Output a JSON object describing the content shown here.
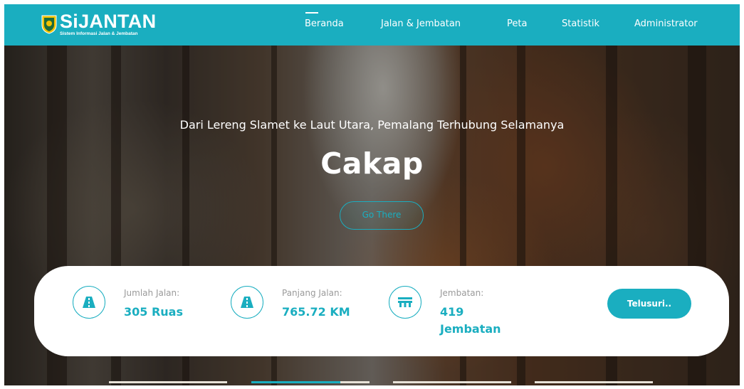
{
  "brand": {
    "name": "SiJANTAN",
    "subtitle": "Sistem Informasi Jalan & Jembatan"
  },
  "nav": {
    "items": [
      {
        "label": "Beranda",
        "active": true
      },
      {
        "label": "Jalan & Jembatan",
        "active": false
      },
      {
        "label": "Peta",
        "active": false
      },
      {
        "label": "Statistik",
        "active": false
      },
      {
        "label": "Administrator",
        "active": false
      }
    ]
  },
  "hero": {
    "tagline": "Dari Lereng Slamet ke Laut Utara, Pemalang Terhubung Selamanya",
    "title": "Cakap",
    "button_label": "Go There"
  },
  "stats": [
    {
      "label": "Jumlah Jalan:",
      "value": "305 Ruas",
      "icon": "road-icon"
    },
    {
      "label": "Panjang Jalan:",
      "value": "765.72 KM",
      "icon": "road-icon"
    },
    {
      "label": "Jembatan:",
      "value_line1": "419",
      "value_line2": "Jembatan",
      "icon": "bridge-icon"
    }
  ],
  "cta": {
    "label": "Telusuri.."
  },
  "slider": {
    "count": 4,
    "active_index": 1,
    "active_progress": 0.75
  },
  "colors": {
    "accent": "#1aaec0",
    "white": "#ffffff",
    "muted_text": "#9a9a9a"
  }
}
